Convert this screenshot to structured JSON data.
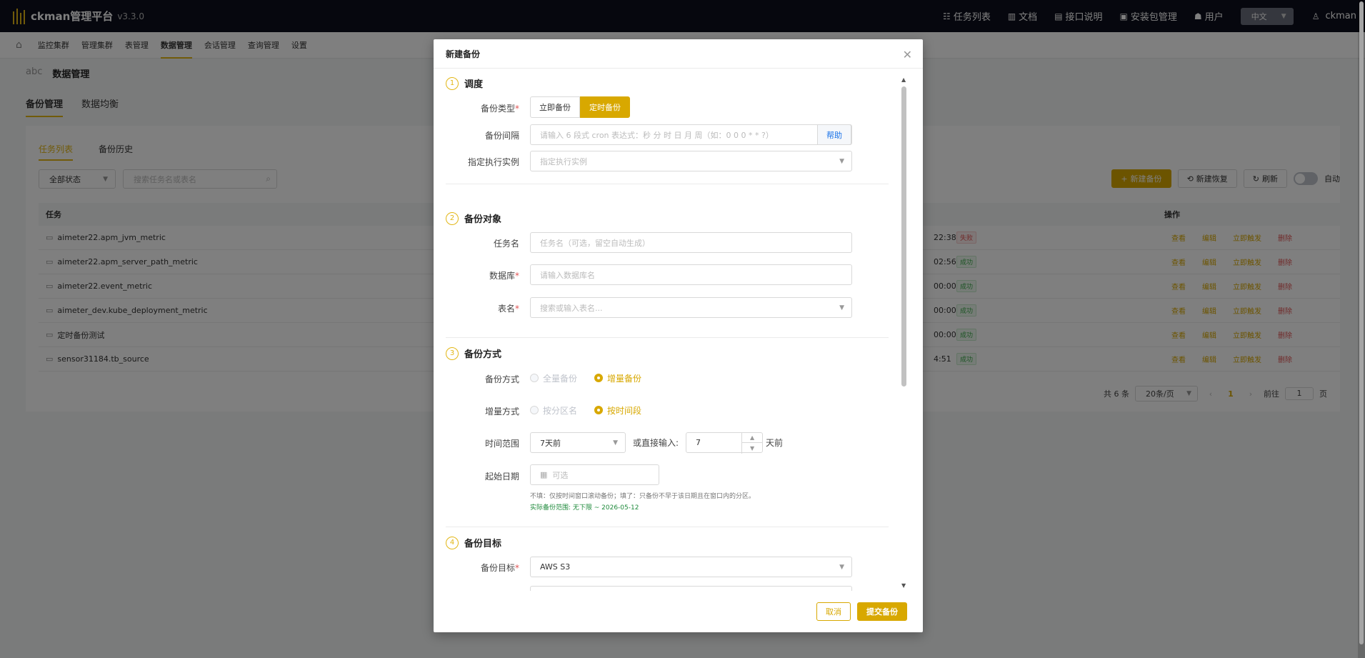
{
  "app": {
    "title": "ckman管理平台",
    "version": "v3.3.0"
  },
  "topnav": {
    "items": [
      {
        "icon": "task-list-icon",
        "label": "任务列表"
      },
      {
        "icon": "book-icon",
        "label": "文档"
      },
      {
        "icon": "doc-icon",
        "label": "接口说明"
      },
      {
        "icon": "package-icon",
        "label": "安装包管理"
      },
      {
        "icon": "users-icon",
        "label": "用户"
      }
    ],
    "language": "中文",
    "user": "ckman"
  },
  "subnav": {
    "items": [
      "监控集群",
      "管理集群",
      "表管理",
      "数据管理",
      "会话管理",
      "查询管理",
      "设置"
    ],
    "active": "数据管理"
  },
  "breadcrumb": {
    "cluster": "abc",
    "page": "数据管理"
  },
  "page_tabs": [
    "备份管理",
    "数据均衡"
  ],
  "sub_tabs": [
    "任务列表",
    "备份历史"
  ],
  "filter": {
    "status": "全部状态",
    "search_placeholder": "搜索任务名或表名"
  },
  "actions": {
    "new_backup": "新建备份",
    "new_restore": "新建恢复",
    "refresh": "刷新",
    "auto": "自动"
  },
  "table": {
    "headers": {
      "task": "任务",
      "ops": "操作"
    },
    "ops": [
      "查看",
      "编辑",
      "立即触发",
      "删除"
    ],
    "rows": [
      {
        "name": "aimeter22.apm_jvm_metric",
        "time": "22:38",
        "status": "失败",
        "ok": false
      },
      {
        "name": "aimeter22.apm_server_path_metric",
        "time": "02:56",
        "status": "成功",
        "ok": true
      },
      {
        "name": "aimeter22.event_metric",
        "time": "00:00",
        "status": "成功",
        "ok": true
      },
      {
        "name": "aimeter_dev.kube_deployment_metric",
        "time": "00:00",
        "status": "成功",
        "ok": true
      },
      {
        "name": "定时备份测试",
        "time": "00:00",
        "status": "成功",
        "ok": true
      },
      {
        "name": "sensor31184.tb_source",
        "time": "4:51",
        "status": "成功",
        "ok": true
      }
    ]
  },
  "pager": {
    "total": "共 6 条",
    "size": "20条/页",
    "current": "1",
    "goto_label": "前往",
    "goto_value": "1",
    "page_unit": "页"
  },
  "modal": {
    "title": "新建备份",
    "sections": [
      {
        "num": "1",
        "title": "调度"
      },
      {
        "num": "2",
        "title": "备份对象"
      },
      {
        "num": "3",
        "title": "备份方式"
      },
      {
        "num": "4",
        "title": "备份目标"
      }
    ],
    "backup_type": {
      "label": "备份类型",
      "options": [
        "立即备份",
        "定时备份"
      ],
      "selected": "定时备份"
    },
    "interval": {
      "label": "备份间隔",
      "placeholder": "请输入 6 段式 cron 表达式：秒 分 时 日 月 周（如：0 0 0 * * ?）",
      "help": "帮助"
    },
    "instance": {
      "label": "指定执行实例",
      "placeholder": "指定执行实例"
    },
    "task_name": {
      "label": "任务名",
      "placeholder": "任务名（可选，留空自动生成）"
    },
    "database": {
      "label": "数据库",
      "placeholder": "请输入数据库名"
    },
    "table_name": {
      "label": "表名",
      "placeholder": "搜索或输入表名..."
    },
    "method": {
      "label": "备份方式",
      "options": [
        "全量备份",
        "增量备份"
      ],
      "selected": "增量备份"
    },
    "inc_method": {
      "label": "增量方式",
      "options": [
        "按分区名",
        "按时间段"
      ],
      "selected": "按时间段"
    },
    "time_range": {
      "label": "时间范围",
      "value": "7天前",
      "direct_label": "或直接输入:",
      "direct_value": "7",
      "unit": "天前"
    },
    "start_date": {
      "label": "起始日期",
      "placeholder": "可选",
      "hint": "不填：仅按时间窗口滚动备份；填了：只备份不早于该日期且在窗口内的分区。",
      "actual": "实际备份范围: 无下限 ~ 2026-05-12"
    },
    "target": {
      "label": "备份目标",
      "value": "AWS S3"
    },
    "cancel": "取消",
    "submit": "提交备份"
  }
}
